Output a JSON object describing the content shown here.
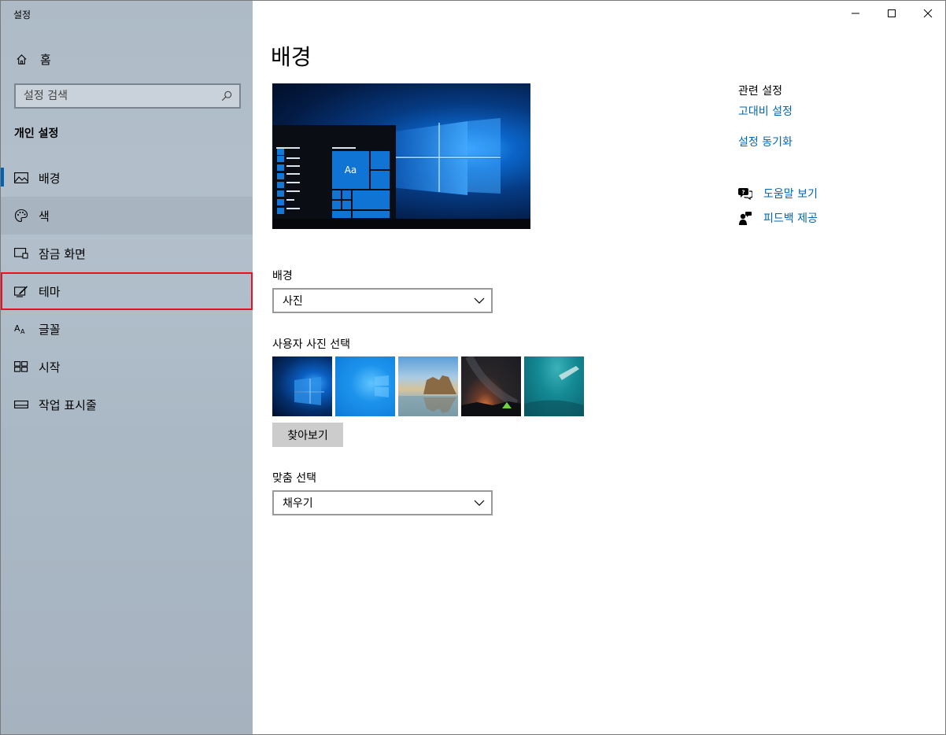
{
  "window": {
    "title": "설정"
  },
  "sidebar": {
    "home_label": "홈",
    "search_placeholder": "설정 검색",
    "section_heading": "개인 설정",
    "items": [
      {
        "label": "배경",
        "icon": "picture-icon",
        "selected": true
      },
      {
        "label": "색",
        "icon": "palette-icon"
      },
      {
        "label": "잠금 화면",
        "icon": "lock-screen-icon"
      },
      {
        "label": "테마",
        "icon": "theme-brush-icon"
      },
      {
        "label": "글꼴",
        "icon": "font-icon"
      },
      {
        "label": "시작",
        "icon": "start-tiles-icon"
      },
      {
        "label": "작업 표시줄",
        "icon": "taskbar-icon"
      }
    ]
  },
  "main": {
    "title": "배경",
    "preview": {
      "tile_label": "Aa"
    },
    "background_label": "배경",
    "background_value": "사진",
    "choose_picture_label": "사용자 사진 선택",
    "browse_label": "찾아보기",
    "fit_label": "맞춤 선택",
    "fit_value": "채우기"
  },
  "related": {
    "title": "관련 설정",
    "links": [
      "고대비 설정",
      "설정 동기화"
    ],
    "help_label": "도움말 보기",
    "feedback_label": "피드백 제공"
  },
  "colors": {
    "accent": "#0063b1",
    "link": "#0066b4",
    "highlight_outline": "#e81123"
  }
}
